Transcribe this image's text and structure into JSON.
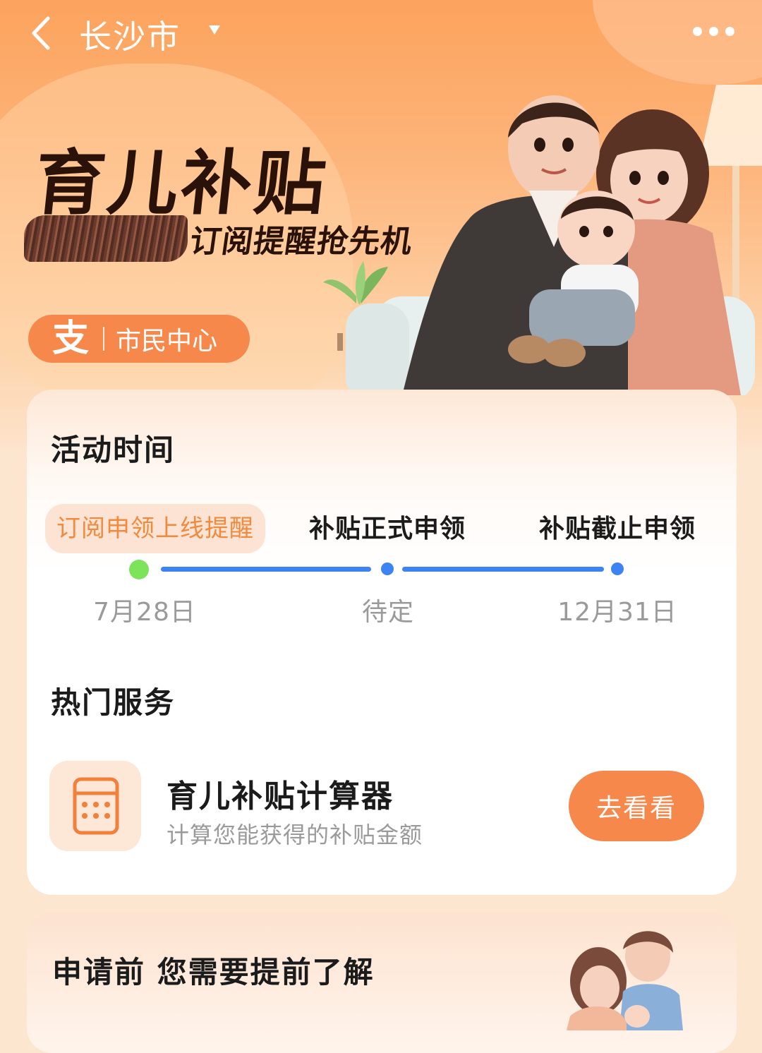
{
  "header": {
    "city": "长沙市",
    "back_icon": "chevron-left-icon",
    "dropdown_icon": "caret-down-icon",
    "more_icon": "more-dots-icon"
  },
  "hero": {
    "title": "育儿补贴",
    "subtitle": "订阅提醒抢先机",
    "badge": {
      "logo": "支",
      "label": "市民中心"
    }
  },
  "activity": {
    "title": "活动时间",
    "milestones": [
      {
        "label": "订阅申领上线提醒",
        "date": "7月28日",
        "active": true
      },
      {
        "label": "补贴正式申领",
        "date": "待定",
        "active": false
      },
      {
        "label": "补贴截止申领",
        "date": "12月31日",
        "active": false
      }
    ]
  },
  "services": {
    "title": "热门服务",
    "items": [
      {
        "name": "育儿补贴计算器",
        "desc": "计算您能获得的补贴金额",
        "button": "去看看",
        "icon": "calculator-icon"
      }
    ]
  },
  "info": {
    "title": "申请前 您需要提前了解"
  },
  "colors": {
    "accent": "#f7884b",
    "accent_light": "#fde3d3",
    "active_text": "#f08a3e",
    "timeline_blue": "#3d83f2",
    "active_dot": "#7de35a"
  }
}
